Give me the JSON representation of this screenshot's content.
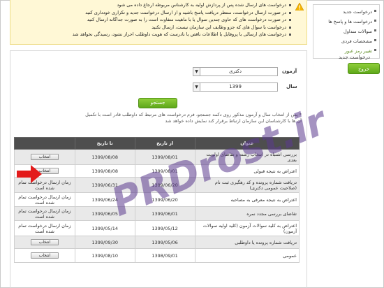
{
  "alert": {
    "lines": [
      "درخواست های ارسال شده پس از پردازش اولیه به کارشناس مربوطه ارجاع داده می شود",
      "در صورت ارسال درخواست، منتظر دریافت پاسخ باشید و از ارسال درخواست جدید و تکراری خودداری کنید",
      "در صورت درخواست های که حاوی چندین سوال یا با ماهیت متفاوت است را به صورت جداگانه ارسال کنید",
      "درخواست با سوال های که جزو وظایف این سازمان نیست، ارسال نکنید",
      "درخواست های ارسالی با پروفایل یا اطلاعات ناقص یا نادرست که هویت داوطلب احراز نشود، رسیدگی نخواهد شد"
    ]
  },
  "sidebar": {
    "items": [
      {
        "label": "درخواست جدید"
      },
      {
        "label": "درخواست ها و پاسخ ها"
      },
      {
        "label": "سوالات متداول"
      },
      {
        "label": "مشخصات فردی"
      },
      {
        "label": "تغییر رمز عبور"
      }
    ],
    "logout_label": "خروج"
  },
  "section": {
    "title": "درخواست جدید",
    "exam_label": "آزمون",
    "exam_value": "دکتری",
    "year_label": "سال",
    "year_value": "1399",
    "search_label": "جستجو",
    "note": "* پس از انتخاب سال و آزمون مذکور روی دکمه جستجو، فرم درخواست های مرتبط که داوطلب قادر است با تکمیل آن ها با کارشناسان این سازمان ارتباط برقرار کند نمایش داده خواهد شد"
  },
  "table": {
    "headers": [
      "عنوان",
      "از تاریخ",
      "تا تاریخ",
      ""
    ],
    "rows": [
      {
        "title": "بررسی اشتباه در انتخاب رشته و تقاضای اولویت بعدی",
        "from": "1399/08/01",
        "to": "1399/08/08",
        "action": "انتخاب",
        "is_button": true
      },
      {
        "title": "اعتراض به نتیجه قبولی",
        "from": "1399/08/01",
        "to": "1399/08/08",
        "action": "انتخاب",
        "is_button": true
      },
      {
        "title": "دریافت شماره پرونده و کد رهگیری ثبت نام (صلاحیت عمومی دکتری)",
        "from": "1399/06/20",
        "to": "1399/06/31",
        "action": "زمان ارسال درخواست تمام شده است",
        "is_button": false
      },
      {
        "title": "اعتراض به نتیجه معرفی به مصاحبه",
        "from": "1399/06/20",
        "to": "1399/06/24",
        "action": "زمان ارسال درخواست تمام شده است",
        "is_button": false
      },
      {
        "title": "تقاضای بررسی مجدد نمره",
        "from": "1399/06/01",
        "to": "1399/06/05",
        "action": "زمان ارسال درخواست تمام شده است",
        "is_button": false
      },
      {
        "title": "اعتراض به کلید سوالات آزمون (کلید اولیه سوالات آزمون)",
        "from": "1399/05/12",
        "to": "1399/05/14",
        "action": "زمان ارسال درخواست تمام شده است",
        "is_button": false
      },
      {
        "title": "دریافت شماره پرونده یا داوطلبی",
        "from": "1399/05/06",
        "to": "1399/09/30",
        "action": "انتخاب",
        "is_button": true
      },
      {
        "title": "عمومی",
        "from": "1398/09/01",
        "to": "1399/08/10",
        "action": "انتخاب",
        "is_button": true
      }
    ]
  },
  "watermark": {
    "text": "PRDrost.ir"
  },
  "colors": {
    "accent_green": "#6cb52a",
    "header_dark": "#4e4e4e",
    "alert_bg": "#fff8d6",
    "arrow_red": "#e31b1b"
  }
}
